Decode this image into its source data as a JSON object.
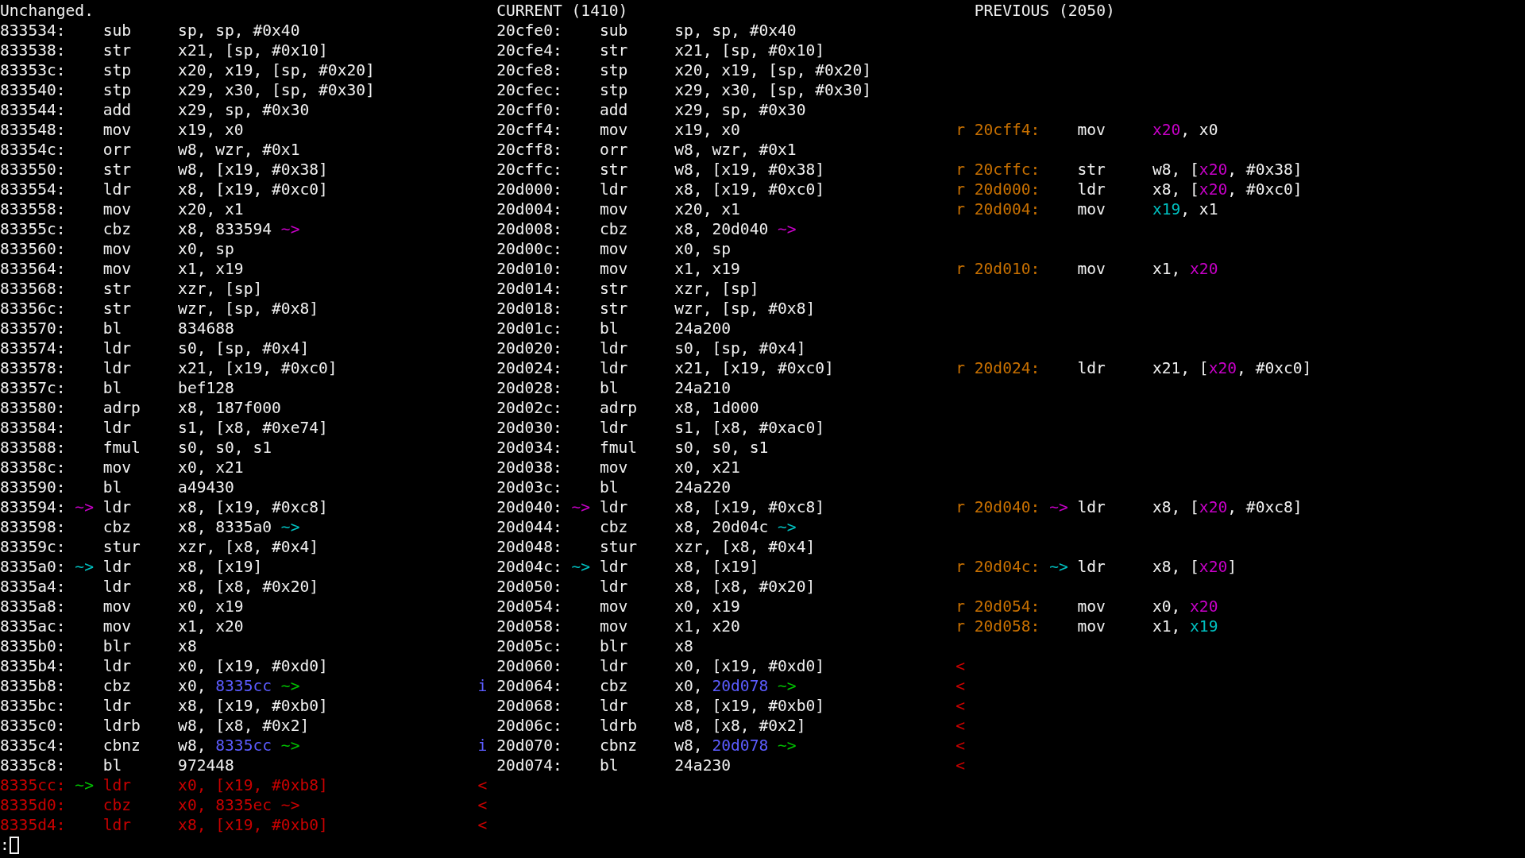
{
  "headers": {
    "left": "Unchanged.",
    "current": "CURRENT (1410)",
    "previous": "PREVIOUS (2050)"
  },
  "rows": [
    {
      "left": {
        "kind": "same",
        "addr": "833534:",
        "op": "sub",
        "args": "sp, sp, #0x40"
      },
      "current": {
        "kind": "same",
        "addr": "20cfe0:",
        "op": "sub",
        "args": "sp, sp, #0x40"
      }
    },
    {
      "left": {
        "kind": "same",
        "addr": "833538:",
        "op": "str",
        "args": "x21, [sp, #0x10]"
      },
      "current": {
        "kind": "same",
        "addr": "20cfe4:",
        "op": "str",
        "args": "x21, [sp, #0x10]"
      }
    },
    {
      "left": {
        "kind": "same",
        "addr": "83353c:",
        "op": "stp",
        "args": "x20, x19, [sp, #0x20]"
      },
      "current": {
        "kind": "same",
        "addr": "20cfe8:",
        "op": "stp",
        "args": "x20, x19, [sp, #0x20]"
      }
    },
    {
      "left": {
        "kind": "same",
        "addr": "833540:",
        "op": "stp",
        "args": "x29, x30, [sp, #0x30]"
      },
      "current": {
        "kind": "same",
        "addr": "20cfec:",
        "op": "stp",
        "args": "x29, x30, [sp, #0x30]"
      }
    },
    {
      "left": {
        "kind": "same",
        "addr": "833544:",
        "op": "add",
        "args": "x29, sp, #0x30"
      },
      "current": {
        "kind": "same",
        "addr": "20cff0:",
        "op": "add",
        "args": "x29, sp, #0x30"
      }
    },
    {
      "left": {
        "kind": "same",
        "addr": "833548:",
        "op": "mov",
        "args": "x19, x0"
      },
      "current": {
        "kind": "same",
        "addr": "20cff4:",
        "op": "mov",
        "args": "x19, x0"
      },
      "gutter_2": {
        "text": "r",
        "color": "#c87000"
      },
      "previous": {
        "kind": "changed",
        "addr": "20cff4:",
        "op": "mov",
        "args": [
          {
            "text": "x20",
            "color": "#c800c8"
          },
          {
            "text": ", x0"
          }
        ]
      }
    },
    {
      "left": {
        "kind": "same",
        "addr": "83354c:",
        "op": "orr",
        "args": "w8, wzr, #0x1"
      },
      "current": {
        "kind": "same",
        "addr": "20cff8:",
        "op": "orr",
        "args": "w8, wzr, #0x1"
      }
    },
    {
      "left": {
        "kind": "same",
        "addr": "833550:",
        "op": "str",
        "args": "w8, [x19, #0x38]"
      },
      "current": {
        "kind": "same",
        "addr": "20cffc:",
        "op": "str",
        "args": "w8, [x19, #0x38]"
      },
      "gutter_2": {
        "text": "r",
        "color": "#c87000"
      },
      "previous": {
        "kind": "changed",
        "addr": "20cffc:",
        "op": "str",
        "args": [
          {
            "text": "w8, ["
          },
          {
            "text": "x20",
            "color": "#c800c8"
          },
          {
            "text": ", #0x38]"
          }
        ]
      }
    },
    {
      "left": {
        "kind": "same",
        "addr": "833554:",
        "op": "ldr",
        "args": "x8, [x19, #0xc0]"
      },
      "current": {
        "kind": "same",
        "addr": "20d000:",
        "op": "ldr",
        "args": "x8, [x19, #0xc0]"
      },
      "gutter_2": {
        "text": "r",
        "color": "#c87000"
      },
      "previous": {
        "kind": "changed",
        "addr": "20d000:",
        "op": "ldr",
        "args": [
          {
            "text": "x8, ["
          },
          {
            "text": "x20",
            "color": "#c800c8"
          },
          {
            "text": ", #0xc0]"
          }
        ]
      }
    },
    {
      "left": {
        "kind": "same",
        "addr": "833558:",
        "op": "mov",
        "args": "x20, x1"
      },
      "current": {
        "kind": "same",
        "addr": "20d004:",
        "op": "mov",
        "args": "x20, x1"
      },
      "gutter_2": {
        "text": "r",
        "color": "#c87000"
      },
      "previous": {
        "kind": "changed",
        "addr": "20d004:",
        "op": "mov",
        "args": [
          {
            "text": "x19",
            "color": "#00c0c0"
          },
          {
            "text": ", x1"
          }
        ]
      }
    },
    {
      "left": {
        "kind": "same",
        "addr": "83355c:",
        "op": "cbz",
        "args": [
          {
            "text": "x8, 833594 "
          },
          {
            "text": "~>",
            "color": "#c800c8"
          }
        ]
      },
      "current": {
        "kind": "same",
        "addr": "20d008:",
        "op": "cbz",
        "args": [
          {
            "text": "x8, 20d040 "
          },
          {
            "text": "~>",
            "color": "#c800c8"
          }
        ]
      }
    },
    {
      "left": {
        "kind": "same",
        "addr": "833560:",
        "op": "mov",
        "args": "x0, sp"
      },
      "current": {
        "kind": "same",
        "addr": "20d00c:",
        "op": "mov",
        "args": "x0, sp"
      }
    },
    {
      "left": {
        "kind": "same",
        "addr": "833564:",
        "op": "mov",
        "args": "x1, x19"
      },
      "current": {
        "kind": "same",
        "addr": "20d010:",
        "op": "mov",
        "args": "x1, x19"
      },
      "gutter_2": {
        "text": "r",
        "color": "#c87000"
      },
      "previous": {
        "kind": "changed",
        "addr": "20d010:",
        "op": "mov",
        "args": [
          {
            "text": "x1, "
          },
          {
            "text": "x20",
            "color": "#c800c8"
          }
        ]
      }
    },
    {
      "left": {
        "kind": "same",
        "addr": "833568:",
        "op": "str",
        "args": "xzr, [sp]"
      },
      "current": {
        "kind": "same",
        "addr": "20d014:",
        "op": "str",
        "args": "xzr, [sp]"
      }
    },
    {
      "left": {
        "kind": "same",
        "addr": "83356c:",
        "op": "str",
        "args": "wzr, [sp, #0x8]"
      },
      "current": {
        "kind": "same",
        "addr": "20d018:",
        "op": "str",
        "args": "wzr, [sp, #0x8]"
      }
    },
    {
      "left": {
        "kind": "same",
        "addr": "833570:",
        "op": "bl",
        "args": "834688"
      },
      "current": {
        "kind": "same",
        "addr": "20d01c:",
        "op": "bl",
        "args": "24a200"
      }
    },
    {
      "left": {
        "kind": "same",
        "addr": "833574:",
        "op": "ldr",
        "args": "s0, [sp, #0x4]"
      },
      "current": {
        "kind": "same",
        "addr": "20d020:",
        "op": "ldr",
        "args": "s0, [sp, #0x4]"
      }
    },
    {
      "left": {
        "kind": "same",
        "addr": "833578:",
        "op": "ldr",
        "args": "x21, [x19, #0xc0]"
      },
      "current": {
        "kind": "same",
        "addr": "20d024:",
        "op": "ldr",
        "args": "x21, [x19, #0xc0]"
      },
      "gutter_2": {
        "text": "r",
        "color": "#c87000"
      },
      "previous": {
        "kind": "changed",
        "addr": "20d024:",
        "op": "ldr",
        "args": [
          {
            "text": "x21, ["
          },
          {
            "text": "x20",
            "color": "#c800c8"
          },
          {
            "text": ", #0xc0]"
          }
        ]
      }
    },
    {
      "left": {
        "kind": "same",
        "addr": "83357c:",
        "op": "bl",
        "args": "bef128"
      },
      "current": {
        "kind": "same",
        "addr": "20d028:",
        "op": "bl",
        "args": "24a210"
      }
    },
    {
      "left": {
        "kind": "same",
        "addr": "833580:",
        "op": "adrp",
        "args": "x8, 187f000"
      },
      "current": {
        "kind": "same",
        "addr": "20d02c:",
        "op": "adrp",
        "args": "x8, 1d000"
      }
    },
    {
      "left": {
        "kind": "same",
        "addr": "833584:",
        "op": "ldr",
        "args": "s1, [x8, #0xe74]"
      },
      "current": {
        "kind": "same",
        "addr": "20d030:",
        "op": "ldr",
        "args": "s1, [x8, #0xac0]"
      }
    },
    {
      "left": {
        "kind": "same",
        "addr": "833588:",
        "op": "fmul",
        "args": "s0, s0, s1"
      },
      "current": {
        "kind": "same",
        "addr": "20d034:",
        "op": "fmul",
        "args": "s0, s0, s1"
      }
    },
    {
      "left": {
        "kind": "same",
        "addr": "83358c:",
        "op": "mov",
        "args": "x0, x21"
      },
      "current": {
        "kind": "same",
        "addr": "20d038:",
        "op": "mov",
        "args": "x0, x21"
      }
    },
    {
      "left": {
        "kind": "same",
        "addr": "833590:",
        "op": "bl",
        "args": "a49430"
      },
      "current": {
        "kind": "same",
        "addr": "20d03c:",
        "op": "bl",
        "args": "24a220"
      }
    },
    {
      "left": {
        "kind": "same",
        "addr": "833594:",
        "arrow": {
          "text": "~>",
          "color": "#c800c8"
        },
        "op": "ldr",
        "args": "x8, [x19, #0xc8]"
      },
      "current": {
        "kind": "same",
        "addr": "20d040:",
        "arrow": {
          "text": "~>",
          "color": "#c800c8"
        },
        "op": "ldr",
        "args": "x8, [x19, #0xc8]"
      },
      "gutter_2": {
        "text": "r",
        "color": "#c87000"
      },
      "previous": {
        "kind": "changed",
        "addr": "20d040:",
        "arrow": {
          "text": "~>",
          "color": "#c800c8"
        },
        "op": "ldr",
        "args": [
          {
            "text": "x8, ["
          },
          {
            "text": "x20",
            "color": "#c800c8"
          },
          {
            "text": ", #0xc8]"
          }
        ]
      }
    },
    {
      "left": {
        "kind": "same",
        "addr": "833598:",
        "op": "cbz",
        "args": [
          {
            "text": "x8, 8335a0 "
          },
          {
            "text": "~>",
            "color": "#00c0c0"
          }
        ]
      },
      "current": {
        "kind": "same",
        "addr": "20d044:",
        "op": "cbz",
        "args": [
          {
            "text": "x8, 20d04c "
          },
          {
            "text": "~>",
            "color": "#00c0c0"
          }
        ]
      }
    },
    {
      "left": {
        "kind": "same",
        "addr": "83359c:",
        "op": "stur",
        "args": "xzr, [x8, #0x4]"
      },
      "current": {
        "kind": "same",
        "addr": "20d048:",
        "op": "stur",
        "args": "xzr, [x8, #0x4]"
      }
    },
    {
      "left": {
        "kind": "same",
        "addr": "8335a0:",
        "arrow": {
          "text": "~>",
          "color": "#00c0c0"
        },
        "op": "ldr",
        "args": "x8, [x19]"
      },
      "current": {
        "kind": "same",
        "addr": "20d04c:",
        "arrow": {
          "text": "~>",
          "color": "#00c0c0"
        },
        "op": "ldr",
        "args": "x8, [x19]"
      },
      "gutter_2": {
        "text": "r",
        "color": "#c87000"
      },
      "previous": {
        "kind": "changed",
        "addr": "20d04c:",
        "arrow": {
          "text": "~>",
          "color": "#00c0c0"
        },
        "op": "ldr",
        "args": [
          {
            "text": "x8, ["
          },
          {
            "text": "x20",
            "color": "#c800c8"
          },
          {
            "text": "]"
          }
        ]
      }
    },
    {
      "left": {
        "kind": "same",
        "addr": "8335a4:",
        "op": "ldr",
        "args": "x8, [x8, #0x20]"
      },
      "current": {
        "kind": "same",
        "addr": "20d050:",
        "op": "ldr",
        "args": "x8, [x8, #0x20]"
      }
    },
    {
      "left": {
        "kind": "same",
        "addr": "8335a8:",
        "op": "mov",
        "args": "x0, x19"
      },
      "current": {
        "kind": "same",
        "addr": "20d054:",
        "op": "mov",
        "args": "x0, x19"
      },
      "gutter_2": {
        "text": "r",
        "color": "#c87000"
      },
      "previous": {
        "kind": "changed",
        "addr": "20d054:",
        "op": "mov",
        "args": [
          {
            "text": "x0, "
          },
          {
            "text": "x20",
            "color": "#c800c8"
          }
        ]
      }
    },
    {
      "left": {
        "kind": "same",
        "addr": "8335ac:",
        "op": "mov",
        "args": "x1, x20"
      },
      "current": {
        "kind": "same",
        "addr": "20d058:",
        "op": "mov",
        "args": "x1, x20"
      },
      "gutter_2": {
        "text": "r",
        "color": "#c87000"
      },
      "previous": {
        "kind": "changed",
        "addr": "20d058:",
        "op": "mov",
        "args": [
          {
            "text": "x1, "
          },
          {
            "text": "x19",
            "color": "#00c0c0"
          }
        ]
      }
    },
    {
      "left": {
        "kind": "same",
        "addr": "8335b0:",
        "op": "blr",
        "args": "x8"
      },
      "current": {
        "kind": "same",
        "addr": "20d05c:",
        "op": "blr",
        "args": "x8"
      }
    },
    {
      "left": {
        "kind": "same",
        "addr": "8335b4:",
        "op": "ldr",
        "args": "x0, [x19, #0xd0]"
      },
      "current": {
        "kind": "same",
        "addr": "20d060:",
        "op": "ldr",
        "args": "x0, [x19, #0xd0]"
      },
      "gutter_2": {
        "text": "<",
        "color": "#c80000"
      }
    },
    {
      "left": {
        "kind": "same",
        "addr": "8335b8:",
        "op": "cbz",
        "args": [
          {
            "text": "x0, "
          },
          {
            "text": "8335cc",
            "color": "#5c5cff"
          },
          {
            "text": " ~>",
            "color": "#00c000"
          }
        ]
      },
      "gutter_1": {
        "text": "i",
        "color": "#5c5cff"
      },
      "current": {
        "kind": "same",
        "addr": "20d064:",
        "op": "cbz",
        "args": [
          {
            "text": "x0, "
          },
          {
            "text": "20d078",
            "color": "#5c5cff"
          },
          {
            "text": " ~>",
            "color": "#00c000"
          }
        ]
      },
      "gutter_2": {
        "text": "<",
        "color": "#c80000"
      }
    },
    {
      "left": {
        "kind": "same",
        "addr": "8335bc:",
        "op": "ldr",
        "args": "x8, [x19, #0xb0]"
      },
      "current": {
        "kind": "same",
        "addr": "20d068:",
        "op": "ldr",
        "args": "x8, [x19, #0xb0]"
      },
      "gutter_2": {
        "text": "<",
        "color": "#c80000"
      }
    },
    {
      "left": {
        "kind": "same",
        "addr": "8335c0:",
        "op": "ldrb",
        "args": "w8, [x8, #0x2]"
      },
      "current": {
        "kind": "same",
        "addr": "20d06c:",
        "op": "ldrb",
        "args": "w8, [x8, #0x2]"
      },
      "gutter_2": {
        "text": "<",
        "color": "#c80000"
      }
    },
    {
      "left": {
        "kind": "same",
        "addr": "8335c4:",
        "op": "cbnz",
        "args": [
          {
            "text": "w8, "
          },
          {
            "text": "8335cc",
            "color": "#5c5cff"
          },
          {
            "text": " ~>",
            "color": "#00c000"
          }
        ]
      },
      "gutter_1": {
        "text": "i",
        "color": "#5c5cff"
      },
      "current": {
        "kind": "same",
        "addr": "20d070:",
        "op": "cbnz",
        "args": [
          {
            "text": "w8, "
          },
          {
            "text": "20d078",
            "color": "#5c5cff"
          },
          {
            "text": " ~>",
            "color": "#00c000"
          }
        ]
      },
      "gutter_2": {
        "text": "<",
        "color": "#c80000"
      }
    },
    {
      "left": {
        "kind": "same",
        "addr": "8335c8:",
        "op": "bl",
        "args": "972448"
      },
      "current": {
        "kind": "same",
        "addr": "20d074:",
        "op": "bl",
        "args": "24a230"
      },
      "gutter_2": {
        "text": "<",
        "color": "#c80000"
      }
    },
    {
      "left": {
        "kind": "removed",
        "addr": "8335cc:",
        "arrow": {
          "text": "~>",
          "color": "#00c000"
        },
        "op": "ldr",
        "args": "x0, [x19, #0xb8]"
      },
      "gutter_1": {
        "text": "<",
        "color": "#c80000"
      }
    },
    {
      "left": {
        "kind": "removed",
        "addr": "8335d0:",
        "op": "cbz",
        "args": "x0, 8335ec ~>"
      },
      "gutter_1": {
        "text": "<",
        "color": "#c80000"
      }
    },
    {
      "left": {
        "kind": "removed",
        "addr": "8335d4:",
        "op": "ldr",
        "args": "x8, [x19, #0xb0]"
      },
      "gutter_1": {
        "text": "<",
        "color": "#c80000"
      }
    }
  ],
  "prompt": ":"
}
